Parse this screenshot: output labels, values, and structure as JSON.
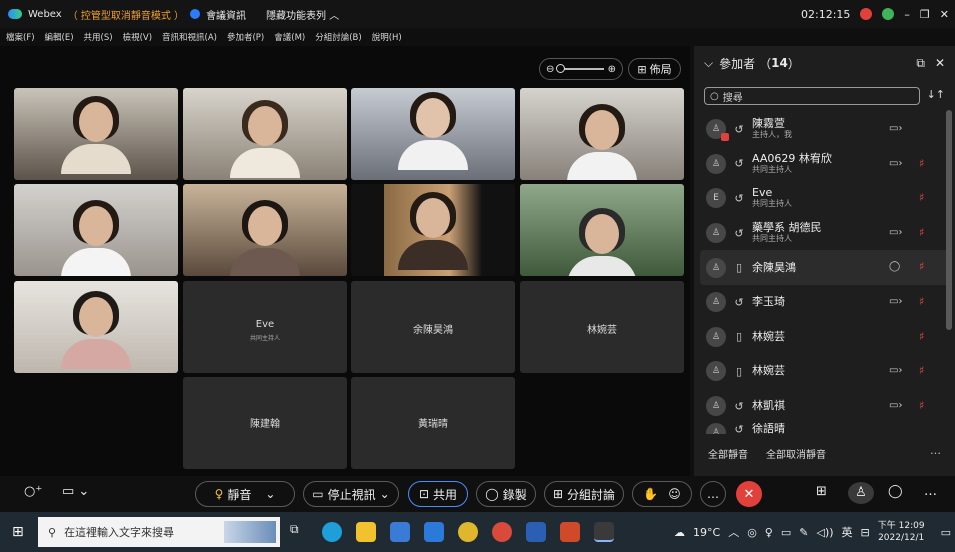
{
  "titlebar": {
    "app_name": "Webex",
    "mode_label": "（ 控管型取消靜音模式 ）",
    "meeting_info": "會議資訊",
    "hide_features": "隱藏功能表列",
    "time": "02:12:15",
    "status_letter": "d"
  },
  "menubar": {
    "items": [
      "檔案(F)",
      "編輯(E)",
      "共用(S)",
      "檢視(V)",
      "音訊和視訊(A)",
      "參加者(P)",
      "會議(M)",
      "分組討論(B)",
      "說明(H)"
    ]
  },
  "stage": {
    "layout_label": "佈局",
    "tiles": [
      {
        "name": "Eve",
        "sub": "共同主持人"
      },
      {
        "name": "余陳昊鴻",
        "sub": ""
      },
      {
        "name": "林婉芸",
        "sub": ""
      },
      {
        "name": "陳建翰",
        "sub": ""
      },
      {
        "name": "黃瑞晴",
        "sub": ""
      }
    ]
  },
  "panel": {
    "title": "參加者",
    "count": "14",
    "search_placeholder": "搜尋",
    "participants": [
      {
        "initial": "",
        "name": "陳霧萱",
        "role": "主持人，我"
      },
      {
        "initial": "",
        "name": "AA0629 林宥欣",
        "role": "共同主持人"
      },
      {
        "initial": "E",
        "name": "Eve",
        "role": "共同主持人"
      },
      {
        "initial": "",
        "name": "藥學系 胡德民",
        "role": "共同主持人"
      },
      {
        "initial": "",
        "name": "余陳昊鴻",
        "role": ""
      },
      {
        "initial": "",
        "name": "李玉琦",
        "role": ""
      },
      {
        "initial": "",
        "name": "林婉芸",
        "role": ""
      },
      {
        "initial": "",
        "name": "林婉芸",
        "role": ""
      },
      {
        "initial": "",
        "name": "林凱祺",
        "role": ""
      },
      {
        "initial": "",
        "name": "徐語晴",
        "role": ""
      }
    ],
    "mute_all": "全部靜音",
    "unmute_all": "全部取消靜音"
  },
  "controls": {
    "mute": "靜音",
    "stop_video": "停止視訊",
    "share": "共用",
    "record": "錄製",
    "breakout": "分組討論"
  },
  "taskbar": {
    "search_placeholder": "在這裡輸入文字來搜尋",
    "weather": "19°C",
    "ime": "英",
    "time": "下午 12:09",
    "date": "2022/12/1"
  },
  "colors": {
    "accent_blue": "#4a8dff",
    "end_red": "#e2403a",
    "mode_orange": "#f0a030"
  }
}
